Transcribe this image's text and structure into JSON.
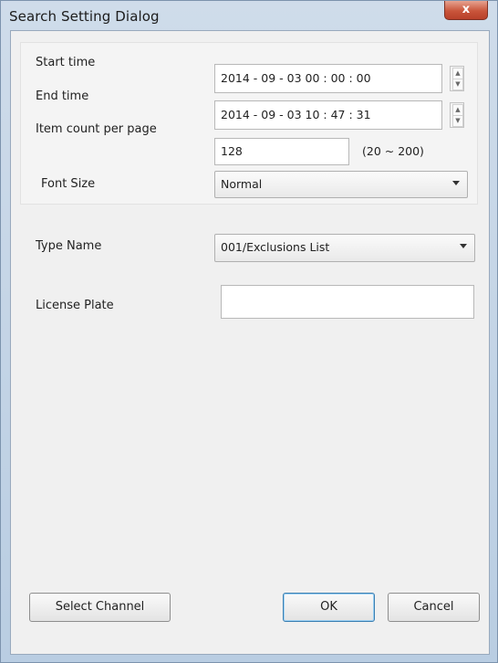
{
  "window": {
    "title": "Search Setting Dialog",
    "close_label": "x"
  },
  "form": {
    "start_time": {
      "label": "Start time",
      "value": "2014 - 09 - 03  00 : 00 : 00"
    },
    "end_time": {
      "label": "End time",
      "value": "2014 - 09 - 03  10 : 47 : 31"
    },
    "item_count": {
      "label": "Item count per page",
      "value": "128",
      "range": "(20 ~ 200)"
    },
    "font_size": {
      "label": "Font Size",
      "value": "Normal"
    },
    "type_name": {
      "label": "Type Name",
      "value": "001/Exclusions List"
    },
    "license_plate": {
      "label": "License Plate",
      "value": ""
    }
  },
  "buttons": {
    "select_channel": "Select Channel",
    "ok": "OK",
    "cancel": "Cancel"
  },
  "icons": {
    "spin_up": "▲",
    "spin_down": "▼"
  }
}
